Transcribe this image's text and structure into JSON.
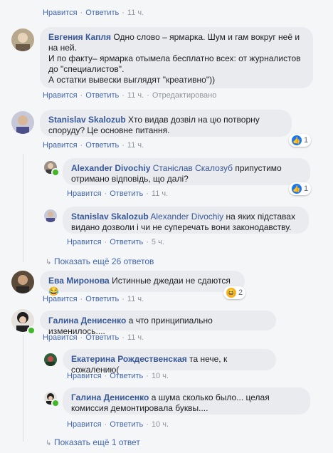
{
  "action_like": "Нравится",
  "action_reply": "Ответить",
  "comments": [
    {
      "id": "top",
      "time": "11 ч."
    },
    {
      "id": "c1",
      "author": "Евгения Капля",
      "text": "Одно слово – ярмарка. Шум и гам вокруг неё и на ней.\nИ по факту– ярмарка отымела бесплатно всех: от журналистов до \"специалистов\".\nА остатки вывески выглядят \"креативно\"))",
      "time": "11 ч.",
      "edited": "Отредактировано"
    },
    {
      "id": "c2",
      "author": "Stanislav Skalozub",
      "text": "Хто видав дозвіл на цю потворну споруду? Це основне питання.",
      "time": "11 ч.",
      "reactions": "1"
    },
    {
      "id": "c2r1",
      "author": "Alexander Divochiy",
      "mention": "Станіслав Скалозуб",
      "text": "припустимо отримано відповідь, що далі?",
      "time": "11 ч.",
      "reactions": "1"
    },
    {
      "id": "c2r2",
      "author": "Stanislav Skalozub",
      "mention": "Alexander Divochiy",
      "text": "на яких підставах видано дозволи і чи не суперечать вони законодавству.",
      "time": "5 ч."
    },
    {
      "id": "c3",
      "author": "Ева Миронова",
      "text": "Истинные джедаи не сдаются 😂",
      "time": "11 ч.",
      "reactions": "2"
    },
    {
      "id": "c4",
      "author": "Галина Денисенко",
      "text": "а что принципиально изменилось....",
      "time": "11 ч."
    },
    {
      "id": "c4r1",
      "author": "Екатерина Рождественская",
      "text": "та нече, к сожалению(",
      "time": "10 ч."
    },
    {
      "id": "c4r2",
      "author": "Галина Денисенко",
      "text": "а шума сколько было... целая комиссия демонтировала буквы....",
      "time": "10 ч."
    }
  ],
  "show_more_1": "Показать ещё 26 ответов",
  "show_more_2": "Показать ещё 1 ответ",
  "colors": {
    "link": "#385898",
    "action": "#4267b2",
    "bubble": "#e9ebee",
    "online": "#42b72a",
    "like": "#1877f2"
  }
}
